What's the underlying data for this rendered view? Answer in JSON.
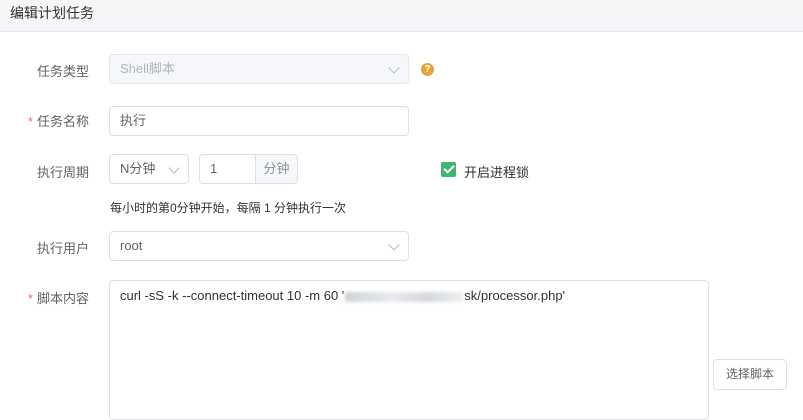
{
  "header": {
    "title": "编辑计划任务"
  },
  "form": {
    "task_type": {
      "label": "任务类型",
      "value": "Shell脚本",
      "help_icon": "question-circle-icon"
    },
    "task_name": {
      "label": "任务名称",
      "required_mark": "*",
      "value": "执行"
    },
    "period": {
      "label": "执行周期",
      "type_value": "N分钟",
      "number_value": "1",
      "unit": "分钟",
      "lock_label": "开启进程锁",
      "lock_checked": true,
      "hint": "每小时的第0分钟开始，每隔 1 分钟执行一次"
    },
    "user": {
      "label": "执行用户",
      "value": "root"
    },
    "script": {
      "label": "脚本内容",
      "required_mark": "*",
      "content_before": "curl -sS -k --connect-timeout 10 -m 60 '",
      "content_after": "sk/processor.php'",
      "choose_button": "选择脚本"
    }
  },
  "colors": {
    "accent_green": "#3fb56f",
    "required_red": "#f56c6c",
    "help_orange": "#e6a23c"
  }
}
